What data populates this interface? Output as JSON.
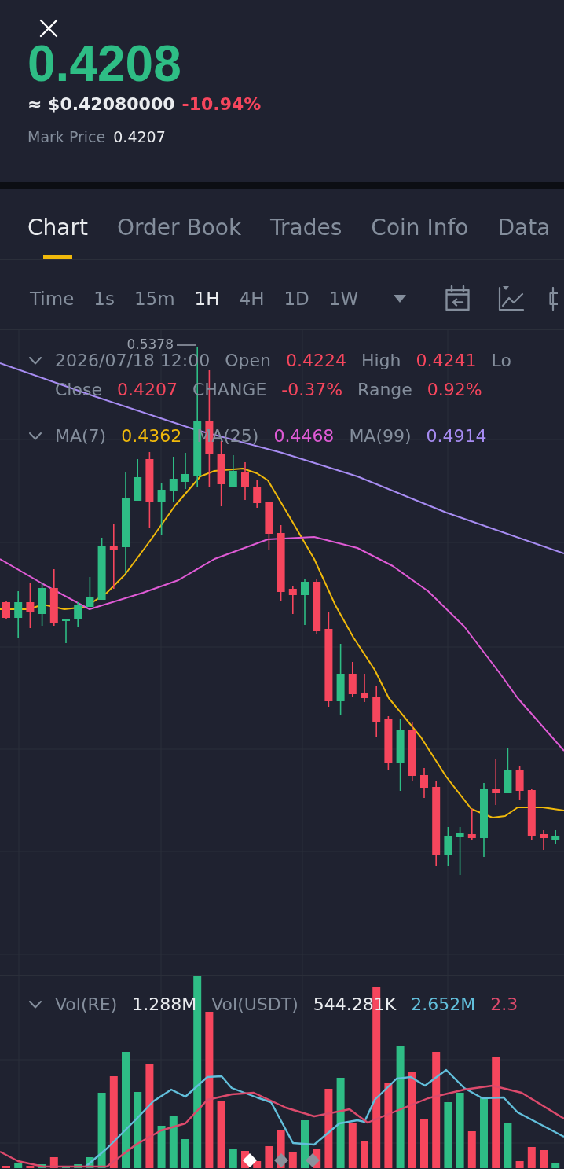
{
  "price": {
    "last": "0.4208",
    "last_rising": true,
    "fiat": "≈ $0.42080000",
    "change": "-10.94%",
    "change_rising": false,
    "mark_price_label": "Mark Price",
    "mark_price": "0.4207"
  },
  "tabs": [
    {
      "label": "Chart",
      "selected": true
    },
    {
      "label": "Order Book",
      "selected": false
    },
    {
      "label": "Trades",
      "selected": false
    },
    {
      "label": "Coin Info",
      "selected": false
    },
    {
      "label": "Data",
      "selected": false
    }
  ],
  "intervals": [
    {
      "label": "Time",
      "selected": false
    },
    {
      "label": "1s",
      "selected": false
    },
    {
      "label": "15m",
      "selected": false
    },
    {
      "label": "1H",
      "selected": true
    },
    {
      "label": "4H",
      "selected": false
    },
    {
      "label": "1D",
      "selected": false
    },
    {
      "label": "1W",
      "selected": false
    }
  ],
  "chart": {
    "ohlc_legend": {
      "rising": false,
      "date": "2026/07/18 12:00",
      "fields": [
        {
          "label": "Open",
          "value": "0.4224"
        },
        {
          "label": "High",
          "value": "0.4241"
        },
        {
          "label": "Lo"
        },
        {
          "label": "Close",
          "value": "0.4207"
        },
        {
          "label": "CHANGE",
          "value": "-0.37%"
        },
        {
          "label": "Range",
          "value": "0.92%"
        }
      ]
    },
    "ma_legend": [
      {
        "label": "MA(7)",
        "value": "0.4362",
        "color": "#f0b90b"
      },
      {
        "label": "MA(25)",
        "value": "0.4468",
        "color": "#e05bd6"
      },
      {
        "label": "MA(99)",
        "value": "0.4914",
        "color": "#a78cf2"
      }
    ],
    "high_marker": "0.5378"
  },
  "volume": {
    "legend": [
      {
        "label": "Vol(RE)",
        "value": "1.288M"
      },
      {
        "label": "Vol(USDT)",
        "value": "544.281K"
      },
      {
        "value": "2.652M",
        "color": "#62bfdb"
      },
      {
        "value": "2.3",
        "color": "#dc4a6c"
      }
    ],
    "markers": [
      {
        "color": "#ffffff"
      },
      {
        "color": "#8b919c"
      },
      {
        "color": "#8b919c"
      }
    ]
  }
}
